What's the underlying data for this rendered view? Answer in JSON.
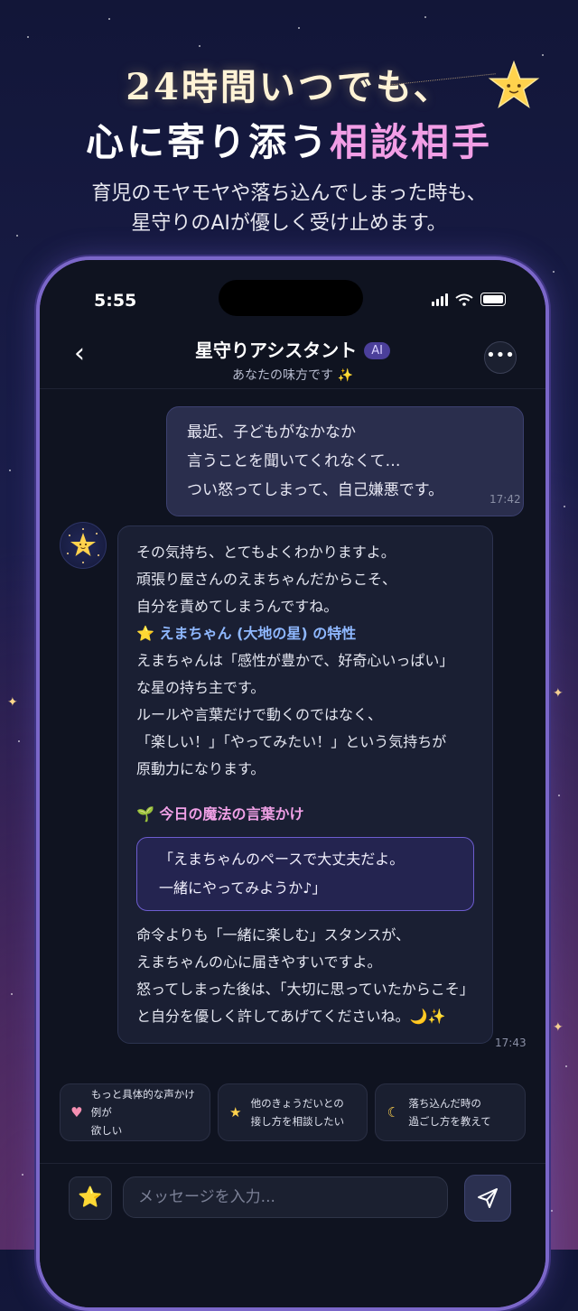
{
  "hero": {
    "line1": "24時間いつでも、",
    "line2_prefix": "心に寄り添う",
    "line2_accent": "相談相手",
    "sub_line1": "育児のモヤモヤや落ち込んでしまった時も、",
    "sub_line2": "星守りのAIが優しく受け止めます。"
  },
  "status": {
    "time": "5:55"
  },
  "header": {
    "back_icon": "‹",
    "title": "星守りアシスタント",
    "badge": "AI",
    "subtitle": "あなたの味方です ✨",
    "more_icon": "•••"
  },
  "user_message": {
    "lines": [
      "最近、子どもがなかなか",
      "言うことを聞いてくれなくて…",
      "つい怒ってしまって、自己嫌悪です。"
    ],
    "time": "17:42"
  },
  "ai_message": {
    "intro": [
      "その気持ち、とてもよくわかりますよ。",
      "頑張り屋さんのえまちゃんだからこそ、",
      "自分を責めてしまうんですね。"
    ],
    "section1_icon": "⭐",
    "section1_title": "えまちゃん (大地の星) の特性",
    "section1_lines": [
      "えまちゃんは「感性が豊かで、好奇心いっぱい」",
      "な星の持ち主です。",
      "ルールや言葉だけで動くのではなく、",
      "「楽しい！」「やってみたい！」という気持ちが",
      "原動力になります。"
    ],
    "section2_icon": "🌱",
    "section2_title": "今日の魔法の言葉かけ",
    "magic_lines": [
      "「えまちゃんのペースで大丈夫だよ。",
      "一緒にやってみようか♪」"
    ],
    "closing": [
      "命令よりも「一緒に楽しむ」スタンスが、",
      "えまちゃんの心に届きやすいですよ。",
      "怒ってしまった後は、「大切に思っていたからこそ」",
      "と自分を優しく許してあげてくださいね。🌙✨"
    ],
    "time": "17:43"
  },
  "chips": [
    {
      "icon": "♥",
      "line1": "もっと具体的な声かけ例が",
      "line2": "欲しい"
    },
    {
      "icon": "★",
      "line1": "他のきょうだいとの",
      "line2": "接し方を相談したい"
    },
    {
      "icon": "☾",
      "line1": "落ち込んだ時の",
      "line2": "過ごし方を教えて"
    }
  ],
  "input": {
    "star_icon": "⭐",
    "placeholder": "メッセージを入力..."
  },
  "colors": {
    "accent_pink": "#f29ee6",
    "accent_blue": "#8fb8ff",
    "frame": "#7b67c9"
  }
}
